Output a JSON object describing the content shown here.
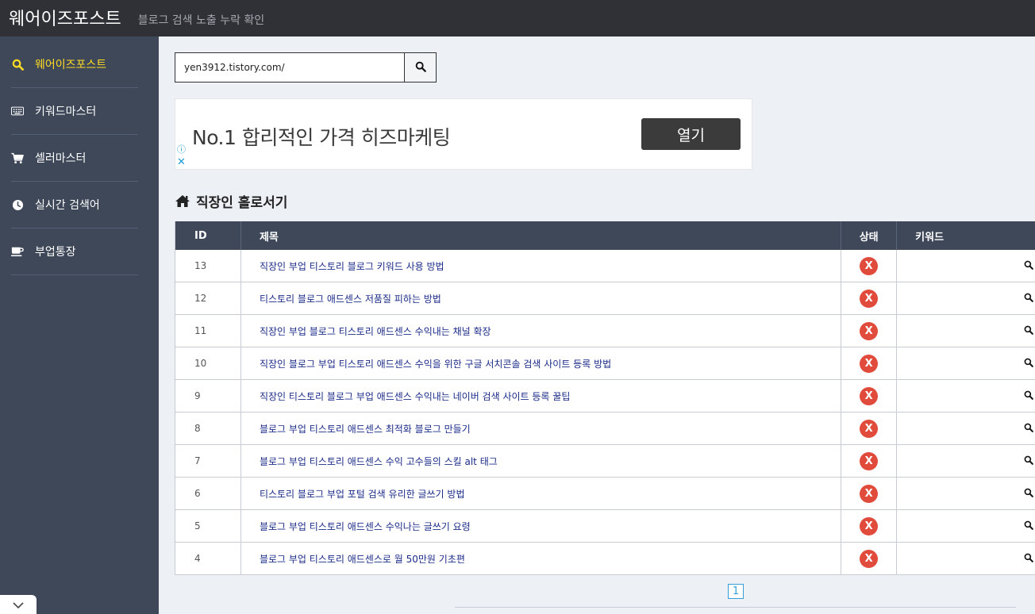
{
  "header": {
    "brand": "웨어이즈포스트",
    "subtitle": "블로그 검색 노출 누락 확인"
  },
  "sidebar": {
    "items": [
      {
        "label": "웨어이즈포스트",
        "icon": "search-icon",
        "active": true
      },
      {
        "label": "키워드마스터",
        "icon": "keyboard-icon",
        "active": false
      },
      {
        "label": "셀러마스터",
        "icon": "cart-icon",
        "active": false
      },
      {
        "label": "실시간 검색어",
        "icon": "clock-icon",
        "active": false
      },
      {
        "label": "부업통장",
        "icon": "coffee-icon",
        "active": false
      }
    ]
  },
  "search": {
    "value": "yen3912.tistory.com/"
  },
  "ad": {
    "text": "No.1 합리적인 가격 히즈마케팅",
    "button": "열기",
    "info_icon": "ⓘ",
    "close_icon": "✕"
  },
  "section": {
    "title": "직장인 홀로서기",
    "icon": "home-icon"
  },
  "table": {
    "headers": {
      "id": "ID",
      "title": "제목",
      "status": "상태",
      "keyword": "키워드"
    },
    "rows": [
      {
        "id": "13",
        "title": "직장인 부업 티스토리 블로그 키워드 사용 방법",
        "status": "X"
      },
      {
        "id": "12",
        "title": "티스토리 블로그 애드센스 저품질 피하는 방법",
        "status": "X"
      },
      {
        "id": "11",
        "title": "직장인 부업 블로그 티스토리 애드센스 수익내는 채널 확장",
        "status": "X"
      },
      {
        "id": "10",
        "title": "직장인 블로그 부업 티스토리 애드센스 수익을 위한 구글 서치콘솔 검색 사이트 등록 방법",
        "status": "X"
      },
      {
        "id": "9",
        "title": "직장인 티스토리 블로그 부업 애드센스 수익내는 네이버 검색 사이트 등록 꿀팁",
        "status": "X"
      },
      {
        "id": "8",
        "title": "블로그 부업 티스토리 애드센스 최적화 블로그 만들기",
        "status": "X"
      },
      {
        "id": "7",
        "title": "블로그 부업 티스토리 애드센스 수익 고수들의 스킬 alt 태그",
        "status": "X"
      },
      {
        "id": "6",
        "title": "티스토리 블로그 부업 포털 검색 유리한 글쓰기 방법",
        "status": "X"
      },
      {
        "id": "5",
        "title": "블로그 부업 티스토리 애드센스 수익나는 글쓰기 요령",
        "status": "X"
      },
      {
        "id": "4",
        "title": "블로그 부업 티스토리 애드센스로 월 50만원 기초편",
        "status": "X"
      }
    ]
  },
  "pagination": {
    "current": "1"
  },
  "colors": {
    "topbar": "#2f3136",
    "sidebar": "#3e4859",
    "active": "#ffdc23",
    "status_bad": "#e04b3b",
    "link": "#1b2b88"
  }
}
